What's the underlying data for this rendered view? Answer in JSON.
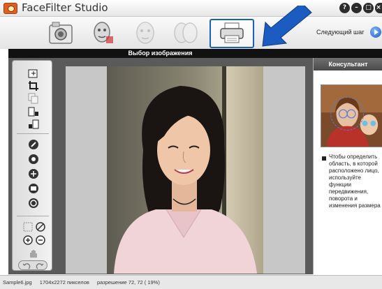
{
  "window": {
    "title": "FaceFilter Studio",
    "controls": [
      "?",
      "–",
      "□",
      "×"
    ]
  },
  "toolbar": {
    "steps": [
      {
        "name": "open-image",
        "icon": "camera-icon",
        "state": "enabled"
      },
      {
        "name": "face-detect",
        "icon": "face-select-icon",
        "state": "enabled"
      },
      {
        "name": "face-edit",
        "icon": "face-edit-icon",
        "state": "dimmed"
      },
      {
        "name": "face-compare",
        "icon": "face-compare-icon",
        "state": "dimmed"
      },
      {
        "name": "print",
        "icon": "printer-icon",
        "state": "active"
      }
    ],
    "next_label": "Следующий шаг",
    "highlight_color": "#1e5ebd"
  },
  "header": {
    "title": "Выбор изображения"
  },
  "tools": {
    "top_group": [
      "open-file-icon",
      "crop-icon",
      "copy-icon",
      "rotate-right-icon",
      "rotate-left-icon"
    ],
    "middle_group": [
      "tool-a-icon",
      "tool-b-icon",
      "tool-c-icon",
      "tool-d-icon",
      "tool-e-icon"
    ],
    "bottom_group": [
      "fit-icon",
      "no-icon",
      "zoom-in-icon",
      "zoom-out-icon",
      "hand-icon",
      "undo-icon",
      "redo-icon"
    ]
  },
  "consultant": {
    "title": "Консультант",
    "lines": [
      "Чтобы определить",
      "область, в которой",
      "расположено лицо,",
      "используйте",
      "функции",
      "передвижения,",
      "поворота и",
      "изменения размера"
    ]
  },
  "status": {
    "file": "Sample6.jpg",
    "pixels": "1704x2272 пикселов",
    "resolution": "разрешение 72, 72 ( 19%)"
  },
  "colors": {
    "background_dark": "#5a5a5a",
    "header_strip": "#111111",
    "accent_arrow": "#1c5bc0"
  }
}
